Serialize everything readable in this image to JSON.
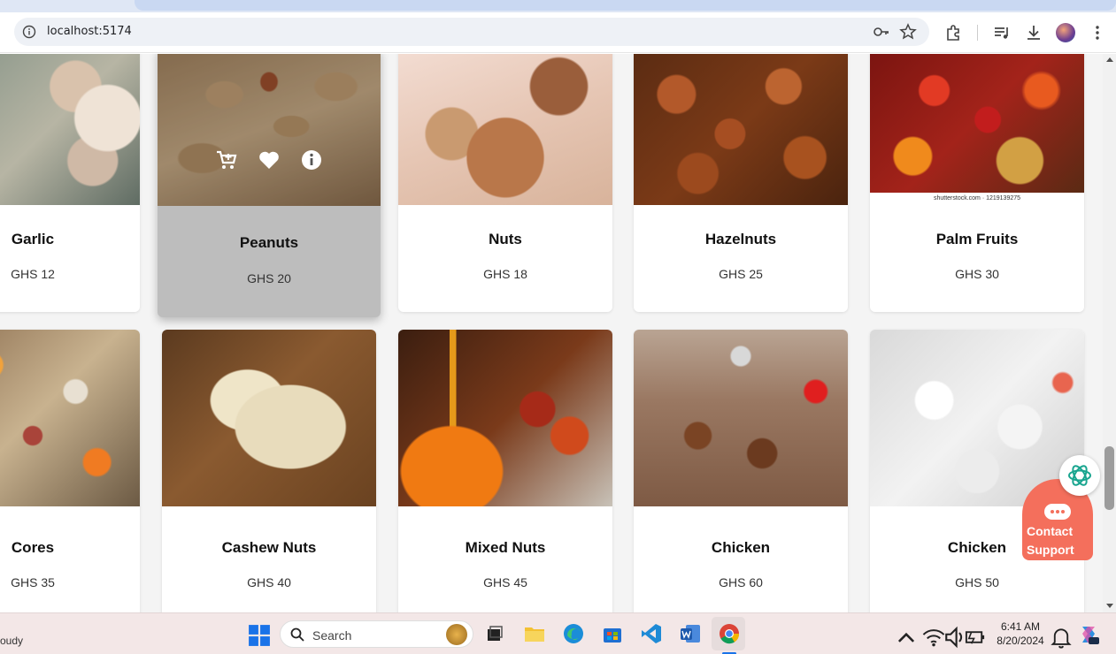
{
  "browser": {
    "url": "localhost:5174"
  },
  "products": [
    {
      "name": "Garlic",
      "price": "GHS 12"
    },
    {
      "name": "Peanuts",
      "price": "GHS 20"
    },
    {
      "name": "Nuts",
      "price": "GHS 18"
    },
    {
      "name": "Hazelnuts",
      "price": "GHS 25"
    },
    {
      "name": "Palm Fruits",
      "price": "GHS 30",
      "watermark": "shutterstock.com · 1219139275"
    },
    {
      "name": "Cores",
      "price": "GHS 35"
    },
    {
      "name": "Cashew Nuts",
      "price": "GHS 40"
    },
    {
      "name": "Mixed Nuts",
      "price": "GHS 45"
    },
    {
      "name": "Chicken",
      "price": "GHS 60"
    },
    {
      "name": "Chicken",
      "price": "GHS 50"
    }
  ],
  "hover_actions": [
    "cart-add-icon",
    "heart-icon",
    "info-icon"
  ],
  "support": {
    "label_line1": "Contact",
    "label_line2": "Support"
  },
  "taskbar": {
    "weather": "oudy",
    "search_label": "Search",
    "time": "6:41 AM",
    "date": "8/20/2024"
  },
  "colors": {
    "support": "#f46f5c",
    "chat_icon": "#19a58f",
    "card_hover": "#bdbdbd"
  }
}
